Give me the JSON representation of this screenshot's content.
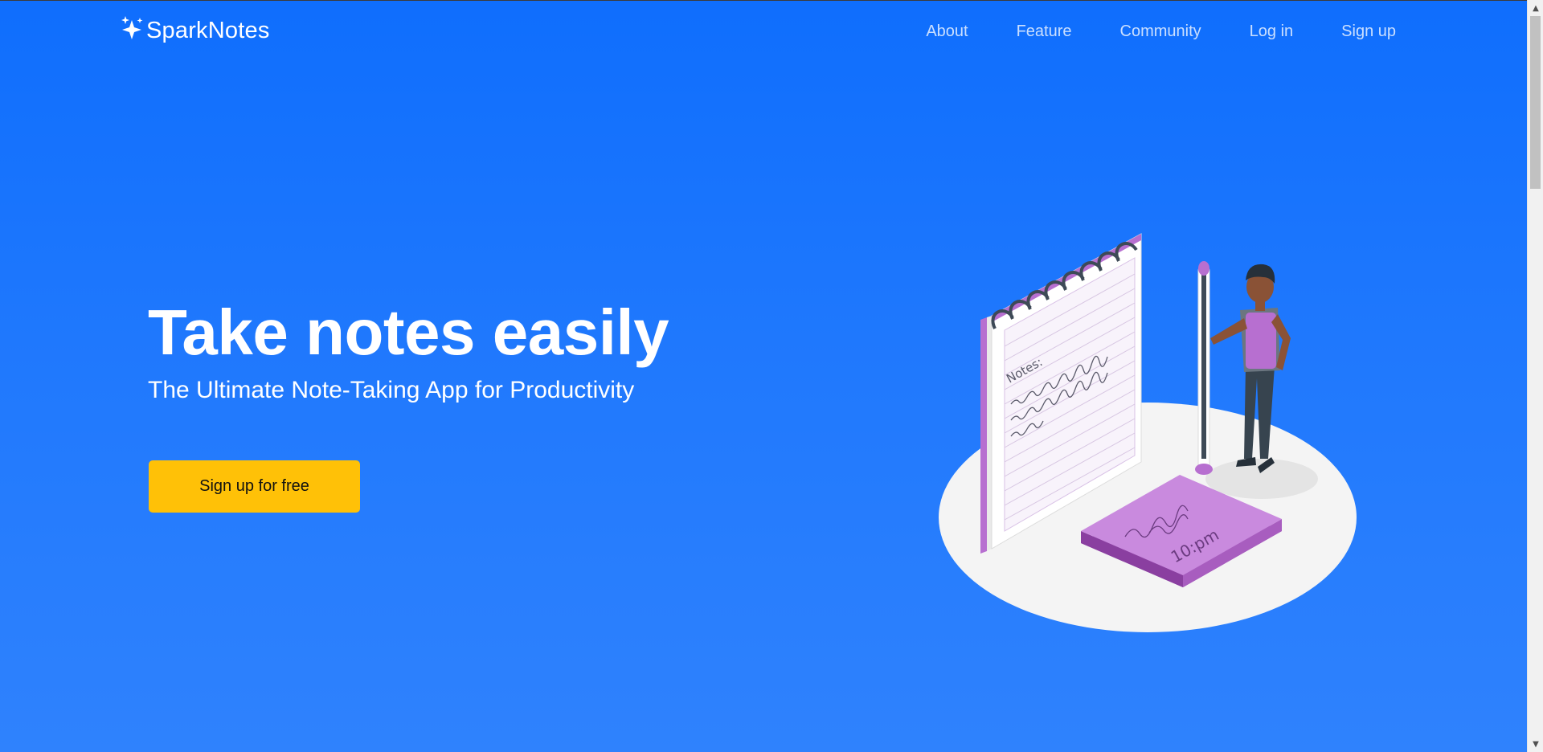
{
  "brand": {
    "name": "SparkNotes",
    "icon": "sparkles-icon"
  },
  "nav": {
    "items": [
      {
        "label": "About"
      },
      {
        "label": "Feature"
      },
      {
        "label": "Community"
      },
      {
        "label": "Log in"
      },
      {
        "label": "Sign up"
      }
    ]
  },
  "hero": {
    "title": "Take notes easily",
    "subtitle": "The Ultimate Note-Taking App for Productivity",
    "cta_label": "Sign up for free"
  },
  "illustration": {
    "notepad_heading": "Notes:",
    "sticky_note_time": "10:pm"
  },
  "colors": {
    "background_top": "#0f6efd",
    "background_bottom": "#2f82fd",
    "cta": "#ffc107",
    "accent_purple": "#b76fd0"
  }
}
